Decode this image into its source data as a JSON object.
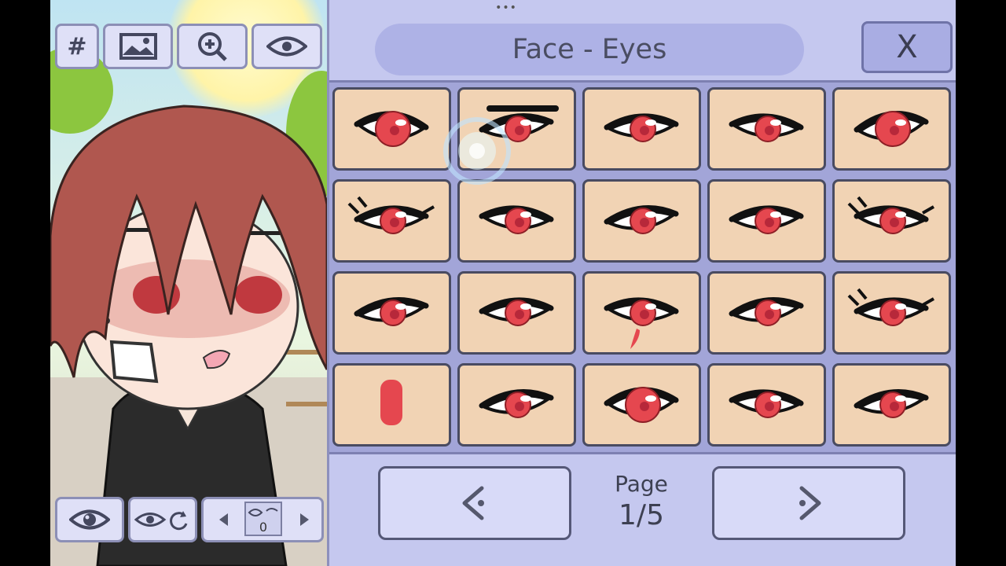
{
  "panel": {
    "title": "Face - Eyes",
    "close_label": "X",
    "drag_handle": "•••",
    "page_label": "Page",
    "page_value": "1/5"
  },
  "toolbar_top": {
    "hash_label": "#",
    "items": [
      "grid-toggle-button",
      "background-image-button",
      "zoom-button",
      "visibility-button"
    ]
  },
  "toolbar_bottom": {
    "slot_value": "0"
  },
  "eye_options": [
    {
      "style": "round"
    },
    {
      "style": "lidded"
    },
    {
      "style": "half"
    },
    {
      "style": "soft"
    },
    {
      "style": "wide"
    },
    {
      "style": "lashes"
    },
    {
      "style": "sharp"
    },
    {
      "style": "narrow"
    },
    {
      "style": "angled"
    },
    {
      "style": "fancy-lashes"
    },
    {
      "style": "thin"
    },
    {
      "style": "flat"
    },
    {
      "style": "tear"
    },
    {
      "style": "sleepy"
    },
    {
      "style": "flick"
    },
    {
      "style": "pill"
    },
    {
      "style": "boxy"
    },
    {
      "style": "almond"
    },
    {
      "style": "shaded"
    },
    {
      "style": "cat"
    }
  ],
  "colors": {
    "iris": "#e5474f",
    "cell_bg": "#f1d3b4",
    "panel_bg": "#c5c8ef"
  }
}
